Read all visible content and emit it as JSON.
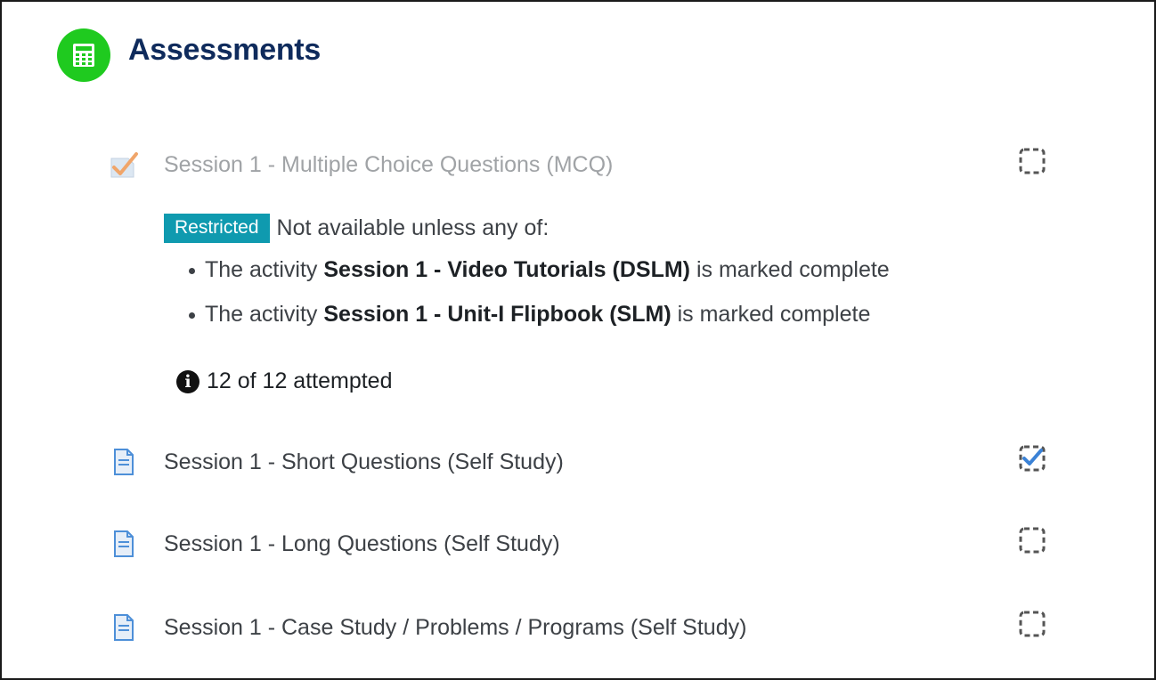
{
  "section": {
    "title": "Assessments",
    "icon": "calculator-icon",
    "icon_bg": "#1fca1f"
  },
  "activities": [
    {
      "name": "Session 1 - Multiple Choice Questions (MCQ)",
      "icon": "quiz-icon",
      "dimmed": true,
      "completion": "incomplete",
      "restriction": {
        "badge": "Restricted",
        "lead": "Not available unless any of:",
        "conditions": [
          {
            "prefix": "The activity ",
            "activity": "Session 1 - Video Tutorials (DSLM)",
            "suffix": " is marked complete"
          },
          {
            "prefix": "The activity ",
            "activity": "Session 1 - Unit-I Flipbook (SLM)",
            "suffix": " is marked complete"
          }
        ]
      },
      "info": "12 of 12 attempted"
    },
    {
      "name": "Session 1 - Short Questions (Self Study)",
      "icon": "page-icon",
      "completion": "complete"
    },
    {
      "name": "Session 1 - Long Questions (Self Study)",
      "icon": "page-icon",
      "completion": "incomplete"
    },
    {
      "name": "Session 1 - Case Study / Problems / Programs (Self Study)",
      "icon": "page-icon",
      "completion": "incomplete"
    }
  ],
  "colors": {
    "title": "#0f2b5c",
    "badge": "#0f9aaf",
    "check": "#3b82d6"
  }
}
